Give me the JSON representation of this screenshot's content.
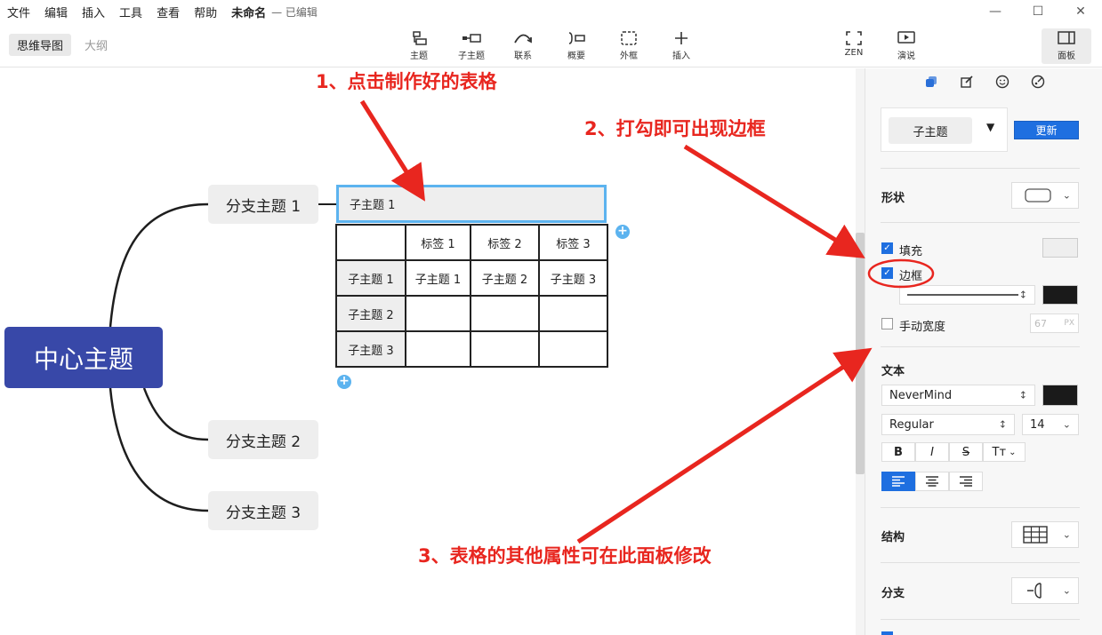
{
  "menu": {
    "items": [
      "文件",
      "编辑",
      "插入",
      "工具",
      "查看",
      "帮助"
    ],
    "doc_name": "未命名",
    "doc_status": "— 已编辑"
  },
  "view_tabs": [
    "思维导图",
    "大纲"
  ],
  "toolbar": {
    "topic": "主题",
    "subtopic": "子主题",
    "relation": "联系",
    "summary": "概要",
    "boundary": "外框",
    "insert": "插入",
    "zen": "ZEN",
    "pitch": "演说",
    "panel": "面板"
  },
  "mindmap": {
    "central": "中心主题",
    "branches": [
      "分支主题 1",
      "分支主题 2",
      "分支主题 3"
    ],
    "table": {
      "title": "子主题 1",
      "col_headers": [
        "",
        "标签 1",
        "标签 2",
        "标签 3"
      ],
      "rows": [
        [
          "子主题 1",
          "子主题 1",
          "子主题 2",
          "子主题 3"
        ],
        [
          "子主题 2",
          "",
          "",
          ""
        ],
        [
          "子主题 3",
          "",
          "",
          ""
        ]
      ]
    }
  },
  "annotations": {
    "a1": "1、点击制作好的表格",
    "a2": "2、打勾即可出现边框",
    "a3": "3、表格的其他属性可在此面板修改"
  },
  "panel": {
    "style_name": "子主题",
    "update_button": "更新",
    "shape_label": "形状",
    "fill_label": "填充",
    "fill_checked": true,
    "border_label": "边框",
    "border_checked": true,
    "manual_width_label": "手动宽度",
    "manual_width_checked": false,
    "width_value": "67",
    "width_unit": "PX",
    "text_label": "文本",
    "font_family": "NeverMind",
    "font_weight": "Regular",
    "font_size": "14",
    "bold": "B",
    "italic": "I",
    "strike": "S",
    "case": "Tт",
    "structure_label": "结构",
    "branch_label": "分支"
  },
  "colors": {
    "central_bg": "#3848a8",
    "accent_blue": "#1e6fe0",
    "selection_border": "#5cb3ef",
    "annotation_red": "#e8261f"
  }
}
